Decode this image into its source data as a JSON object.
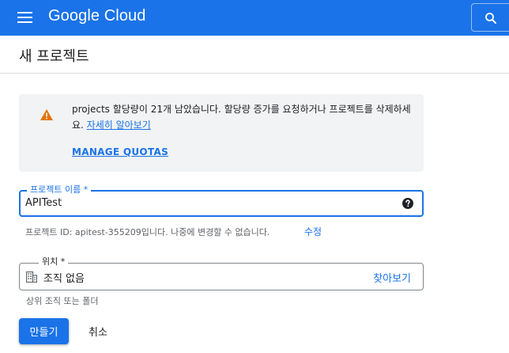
{
  "header": {
    "brand": "Google Cloud",
    "menu_icon": "hamburger-menu-icon",
    "search_icon": "search-icon",
    "background_color": "#1a73e8"
  },
  "page": {
    "title": "새 프로젝트"
  },
  "notice": {
    "icon": "warning-icon",
    "icon_color": "#e37400",
    "text": "projects 할당량이 21개 남았습니다. 할당량 증가를 요청하거나 프로젝트를 삭제하세요. ",
    "link": "자세히 알아보기",
    "manage_quotas": "MANAGE QUOTAS"
  },
  "project_name": {
    "label": "프로젝트 이름 *",
    "value": "APITest",
    "help_icon": "help-icon"
  },
  "project_id": {
    "text": "프로젝트 ID: apitest-355209입니다. 나중에 변경할 수 없습니다.",
    "edit_label": "수정"
  },
  "location": {
    "label": "위치 *",
    "icon": "building-icon",
    "value": "조직 없음",
    "browse_label": "찾아보기",
    "hint": "상위 조직 또는 폴더"
  },
  "actions": {
    "create_label": "만들기",
    "cancel_label": "취소"
  },
  "colors": {
    "accent": "#1a73e8",
    "panel": "#f1f3f4",
    "secondary_text": "#5f6368"
  }
}
